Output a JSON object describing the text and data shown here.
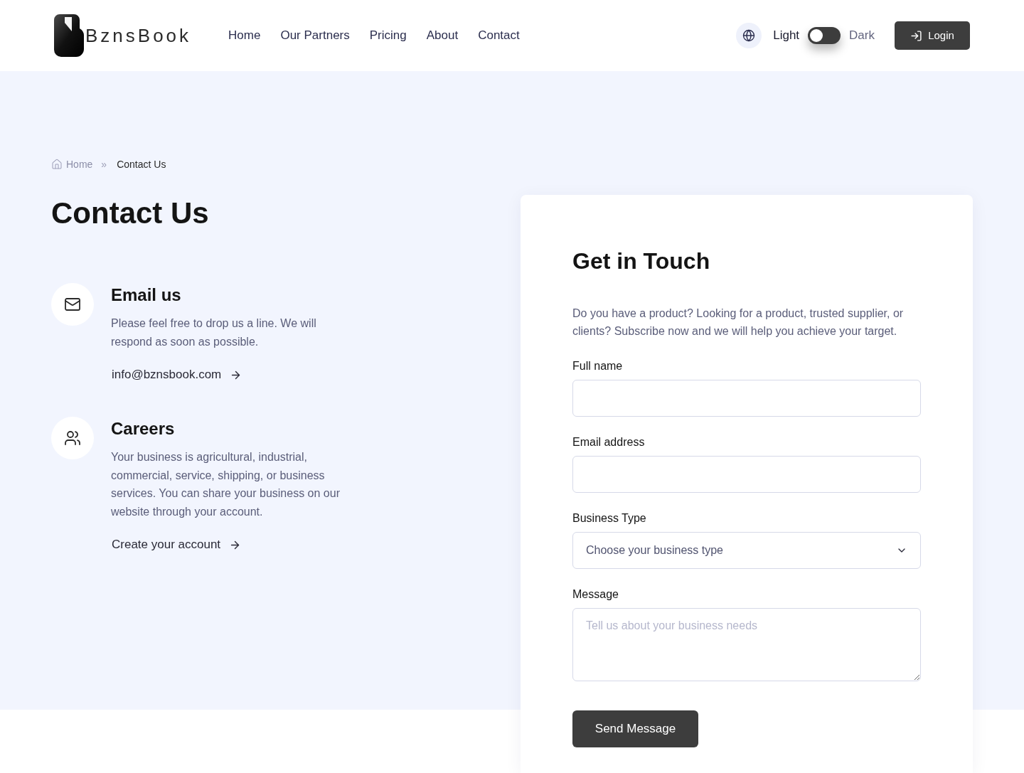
{
  "header": {
    "logo": {
      "text": "BznsBook"
    },
    "nav": [
      {
        "label": "Home"
      },
      {
        "label": "Our Partners"
      },
      {
        "label": "Pricing"
      },
      {
        "label": "About"
      },
      {
        "label": "Contact"
      }
    ],
    "theme_toggle": {
      "left_label": "Light",
      "right_label": "Dark",
      "on": false
    },
    "login_button": {
      "label": "Login"
    }
  },
  "breadcrumb": {
    "home": "Home",
    "separator": "»",
    "current": "Contact Us"
  },
  "page_title": "Contact Us",
  "contact_methods": [
    {
      "kind": "email",
      "title": "Email us",
      "description": "Please feel free to drop us a line. We will respond as soon as possible.",
      "link": "info@bznsbook.com"
    },
    {
      "kind": "careers",
      "title": "Careers",
      "description": "Your business is agricultural, industrial, commercial, service, shipping, or business services. You can share your business on our website through your account.",
      "link": "Create your account"
    }
  ],
  "form": {
    "title": "Get in Touch",
    "description": "Do you have a product? Looking for a product, trusted supplier, or clients? Subscribe now and we will help you achieve your target.",
    "fields": [
      {
        "kind": "text",
        "label": "Full name"
      },
      {
        "kind": "email",
        "label": "Email address"
      },
      {
        "kind": "select",
        "label": "Business Type",
        "placeholder": "Choose your business type"
      },
      {
        "kind": "textarea",
        "label": "Message",
        "placeholder": "Tell us about your business needs"
      }
    ],
    "submit": "Send Message"
  }
}
